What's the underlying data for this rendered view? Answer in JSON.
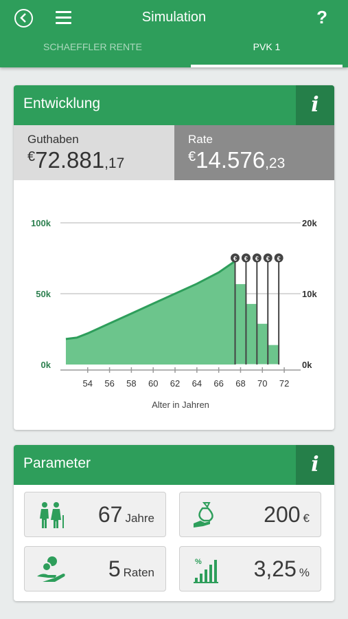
{
  "header": {
    "title": "Simulation",
    "help_label": "?",
    "tabs": [
      {
        "label": "SCHAEFFLER RENTE",
        "active": false
      },
      {
        "label": "PVK 1",
        "active": true
      }
    ]
  },
  "development": {
    "title": "Entwicklung",
    "info_label": "i",
    "balance": {
      "label": "Guthaben",
      "currency": "€",
      "main": "72.881",
      "decimals": ",17"
    },
    "rate": {
      "label": "Rate",
      "currency": "€",
      "main": "14.576",
      "decimals": ",23"
    }
  },
  "chart_data": {
    "type": "area",
    "xlabel": "Alter in Jahren",
    "x_ticks": [
      "54",
      "56",
      "58",
      "60",
      "62",
      "64",
      "66",
      "68",
      "70",
      "72"
    ],
    "xlim": [
      51.5,
      73
    ],
    "y_left_ticks": [
      "0k",
      "50k",
      "100k"
    ],
    "y_right_ticks": [
      "0k",
      "10k",
      "20k"
    ],
    "ylim_left": [
      0,
      100000
    ],
    "ylim_right": [
      0,
      20000
    ],
    "grid": true,
    "series": [
      {
        "axis": "left",
        "type": "area",
        "x": [
          52,
          53,
          54,
          56,
          58,
          60,
          62,
          64,
          66,
          67.5
        ],
        "values": [
          18000,
          19000,
          22000,
          29000,
          36000,
          43000,
          50000,
          57000,
          65000,
          73000
        ]
      },
      {
        "axis": "left",
        "type": "bar",
        "x_start": [
          67.5,
          68.5,
          69.5,
          70.5,
          71.5
        ],
        "x_end": [
          68.5,
          69.5,
          70.5,
          71.5,
          72
        ],
        "values": [
          57000,
          43000,
          29000,
          14000,
          0
        ]
      }
    ],
    "payout_markers": [
      {
        "x": 67.5,
        "label": "€"
      },
      {
        "x": 68.5,
        "label": "€"
      },
      {
        "x": 69.5,
        "label": "€"
      },
      {
        "x": 70.5,
        "label": "€"
      },
      {
        "x": 71.5,
        "label": "€"
      }
    ],
    "colors": {
      "fill": "#6cc58c",
      "stroke": "#2e9e5b",
      "grid": "#cccccc",
      "axis_text": "#2e8050"
    }
  },
  "parameters": {
    "title": "Parameter",
    "info_label": "i",
    "tiles": [
      {
        "icon": "elderly-couple-icon",
        "value": "67",
        "unit": "Jahre"
      },
      {
        "icon": "money-bag-hand-icon",
        "value": "200",
        "unit": "€"
      },
      {
        "icon": "coin-hand-icon",
        "value": "5",
        "unit": "Raten"
      },
      {
        "icon": "percent-growth-chart-icon",
        "value": "3,25",
        "unit": "%"
      }
    ]
  },
  "colors": {
    "brand": "#2e9e5b",
    "brand_dark": "#257f49",
    "balance_bg": "#dcdcdc",
    "rate_bg": "#8b8b8b"
  }
}
